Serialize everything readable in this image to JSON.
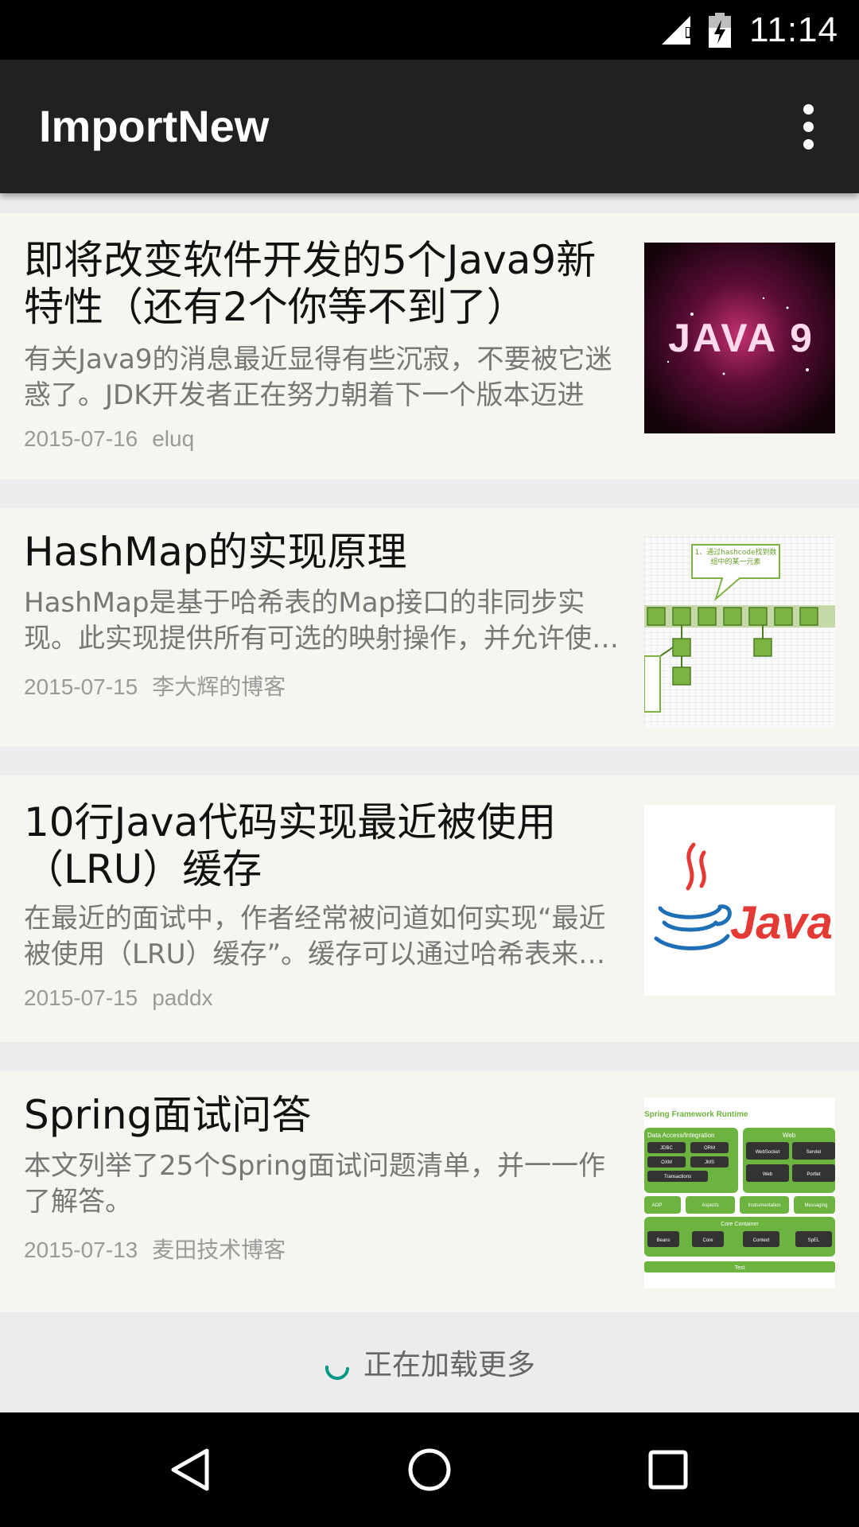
{
  "status_bar": {
    "time": "11:14",
    "icons": [
      "signal-icon",
      "battery-icon"
    ]
  },
  "app_bar": {
    "title": "ImportNew",
    "menu_icon": "overflow-menu-icon"
  },
  "articles": [
    {
      "title": "即将改变软件开发的5个Java9新特性（还有2个你等不到了）",
      "summary": "有关Java9的消息最近显得有些沉寂，不要被它迷惑了。JDK开发者正在努力朝着下一个版本迈进",
      "date": "2015-07-16",
      "author": "eluq",
      "thumb_text": "JAVA 9"
    },
    {
      "title": "HashMap的实现原理",
      "summary": "HashMap是基于哈希表的Map接口的非同步实现。此实现提供所有可选的映射操作，并允许使用null值和null键",
      "date": "2015-07-15",
      "author": "李大辉的博客",
      "thumb_text": "1、通过hashcode找到数组中的某一元素"
    },
    {
      "title": "10行Java代码实现最近被使用（LRU）缓存",
      "summary": "在最近的面试中，作者经常被问道如何实现“最近被使用（LRU）缓存”。缓存可以通过哈希表来实现",
      "date": "2015-07-15",
      "author": "paddx",
      "thumb_text": "Java"
    },
    {
      "title": "Spring面试问答",
      "summary": "本文列举了25个Spring面试问题清单，并一一作了解答。",
      "date": "2015-07-13",
      "author": "麦田技术博客",
      "thumb_text": {
        "header": "Spring Framework Runtime",
        "data_access": "Data Access/Integration",
        "web": "Web",
        "jdbc": "JDBC",
        "orm": "ORM",
        "oxm": "OXM",
        "jms": "JMS",
        "transactions": "Transactions",
        "websocket": "WebSocket",
        "servlet": "Servlet",
        "web_mod": "Web",
        "portlet": "Portlet",
        "aop": "AOP",
        "aspects": "Aspects",
        "instrumentation": "Instrumentation",
        "messaging": "Messaging",
        "core_container": "Core Container",
        "beans": "Beans",
        "core": "Core",
        "context": "Context",
        "spel": "SpEL",
        "test": "Test"
      }
    }
  ],
  "loading": {
    "text": "正在加载更多"
  },
  "nav_bar": {
    "icons": [
      "back-icon",
      "home-icon",
      "recents-icon"
    ]
  },
  "colors": {
    "app_bar": "#212121",
    "card_bg": "#f6f5ef",
    "spinner": "#009688",
    "spring_green": "#6db33f"
  }
}
